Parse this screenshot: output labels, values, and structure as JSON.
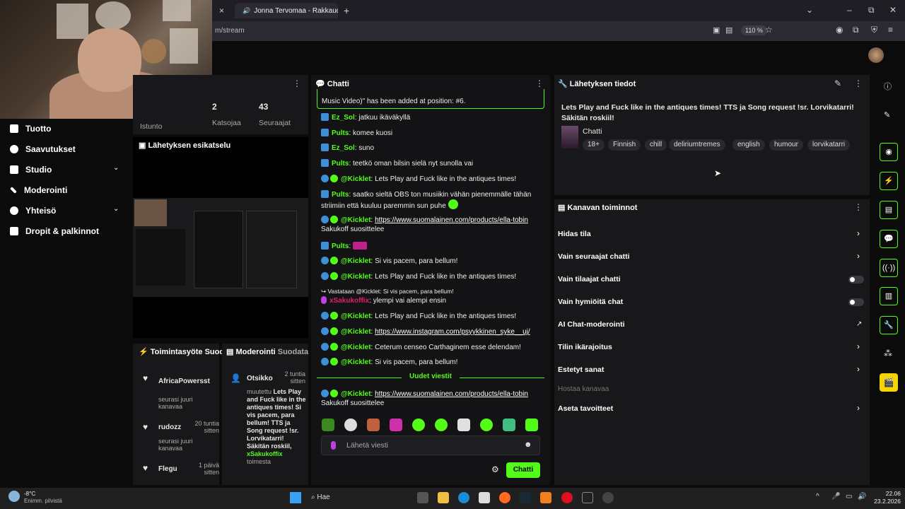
{
  "browser": {
    "tab_title": "Jonna Tervomaa - Rakkaud",
    "tab_close": "×",
    "new_tab": "+",
    "url": "m/stream",
    "zoom": "110 %",
    "win_min": "–",
    "win_max": "⧉",
    "win_close": "✕"
  },
  "stats": {
    "viewers": "2",
    "viewers_label": "Katsojaa",
    "followers": "43",
    "followers_label": "Seuraajat",
    "session_label": "Istunto"
  },
  "nav": [
    {
      "label": "Tuotto",
      "icon": "money-icon"
    },
    {
      "label": "Saavutukset",
      "icon": "trophy-icon"
    },
    {
      "label": "Studio",
      "icon": "studio-icon",
      "chevron": "⌄"
    },
    {
      "label": "Moderointi",
      "icon": "wrench-icon"
    },
    {
      "label": "Yhteisö",
      "icon": "people-icon",
      "chevron": "⌄"
    },
    {
      "label": "Dropit & palkinnot",
      "icon": "gift-icon"
    }
  ],
  "preview": {
    "title": "Lähetyksen esikatselu"
  },
  "activity": {
    "title": "Toimintasyöte",
    "title_cut": "Suod",
    "items": [
      {
        "name": "AfricaPowersst",
        "action": "seurasi juuri kanavaa",
        "time": ""
      },
      {
        "name": "rudozz",
        "action": "seurasi juuri kanavaa",
        "time": "20 tuntia sitten"
      },
      {
        "name": "Flegu",
        "action": "",
        "time": "1 päivä sitten"
      }
    ]
  },
  "moderation": {
    "title": "Moderointi",
    "filter": "Suodata",
    "item_title": "Otsikko",
    "item_time": "2 tuntia sitten",
    "changed": "muutettu",
    "text": "Lets Play and Fuck like in the antiques times! Si vis pacem, para bellum! TTS ja Song request !sr. Lorvikatarri! Säkitän roskiil,",
    "by": "xSakukoffix",
    "by_suffix": "toimesta"
  },
  "chat": {
    "title": "Chatti",
    "pinned": "Music Video)\" has been added at position: #6.",
    "messages": [
      {
        "user": "Ez_Sol",
        "text": ": jatkuu ikäväkyllä"
      },
      {
        "user": "Pults",
        "text": ": komee kuosi"
      },
      {
        "user": "Ez_Sol",
        "text": ": suno"
      },
      {
        "user": "Pults",
        "text": ": teetkö oman bilsin sielä nyt sunolla vai"
      },
      {
        "user": "@Kicklet",
        "text": ": Lets Play and Fuck like in the antiques times!"
      },
      {
        "user": "Pults",
        "text": ": saatko sieltä OBS ton musiikin vähän pienemmälle tähän striimiin että kuuluu paremmin sun puhe"
      },
      {
        "user": "@Kicklet",
        "text": ": ",
        "link": "https://www.suomalainen.com/products/ella-tobin",
        "after": "Sakukoff suosittelee"
      },
      {
        "user": "Pults",
        "text": ":"
      },
      {
        "user": "@Kicklet",
        "text": ": Si vis pacem, para bellum!"
      },
      {
        "user": "@Kicklet",
        "text": ": Lets Play and Fuck like in the antiques times!"
      },
      {
        "reply": "Vastataan @Kicklet: Si vis pacem, para bellum!",
        "user": "xSakukoffix",
        "text": ": ylempi vai alempi ensin"
      },
      {
        "user": "@Kicklet",
        "text": ": Lets Play and Fuck like in the antiques times!"
      },
      {
        "user": "@Kicklet",
        "text": ": ",
        "link": "https://www.instagram.com/psyykkinen_syke__uj/"
      },
      {
        "user": "@Kicklet",
        "text": ": Ceterum censeo Carthaginem esse delendam!"
      },
      {
        "user": "@Kicklet",
        "text": ": Si vis pacem, para bellum!"
      }
    ],
    "new_messages": "Uudet viestit",
    "last": {
      "user": "@Kicklet",
      "text": ": ",
      "link": "https://www.suomalainen.com/products/ella-tobin",
      "after": "Sakukoff suosittelee"
    },
    "input_placeholder": "Lähetä viesti",
    "send": "Chatti"
  },
  "stream_info": {
    "title": "Lähetyksen tiedot",
    "stream_title": "Lets Play and Fuck like in the antiques times! TTS ja Song request !sr. Lorvikatarri! Säkitän roskiil!",
    "category": "Chatti",
    "tags": [
      "18+",
      "Finnish",
      "chill",
      "deliriumtremes",
      "english",
      "humour",
      "lorvikatarri"
    ]
  },
  "channel_tools": {
    "title": "Kanavan toiminnot",
    "rows": [
      {
        "label": "Hidas tila",
        "control": "chevron"
      },
      {
        "label": "Vain seuraajat chatti",
        "control": "chevron"
      },
      {
        "label": "Vain tilaajat chatti",
        "control": "toggle"
      },
      {
        "label": "Vain hymiöitä chat",
        "control": "toggle"
      },
      {
        "label": "AI Chat-moderointi",
        "control": "external"
      },
      {
        "label": "Tilin ikärajoitus",
        "control": "chevron"
      },
      {
        "label": "Estetyt sanat",
        "control": "chevron"
      }
    ],
    "host_label": "Hostaa kanavaa",
    "goals": "Aseta tavoitteet"
  },
  "taskbar": {
    "temp": "-8°C",
    "weather": "Enimm. pilvistä",
    "search": "Hae",
    "time": "22.06",
    "date": "23.2.2026"
  },
  "colors": {
    "accent": "#53fc18",
    "panel": "#18181b",
    "bg": "#0b0b0c"
  }
}
